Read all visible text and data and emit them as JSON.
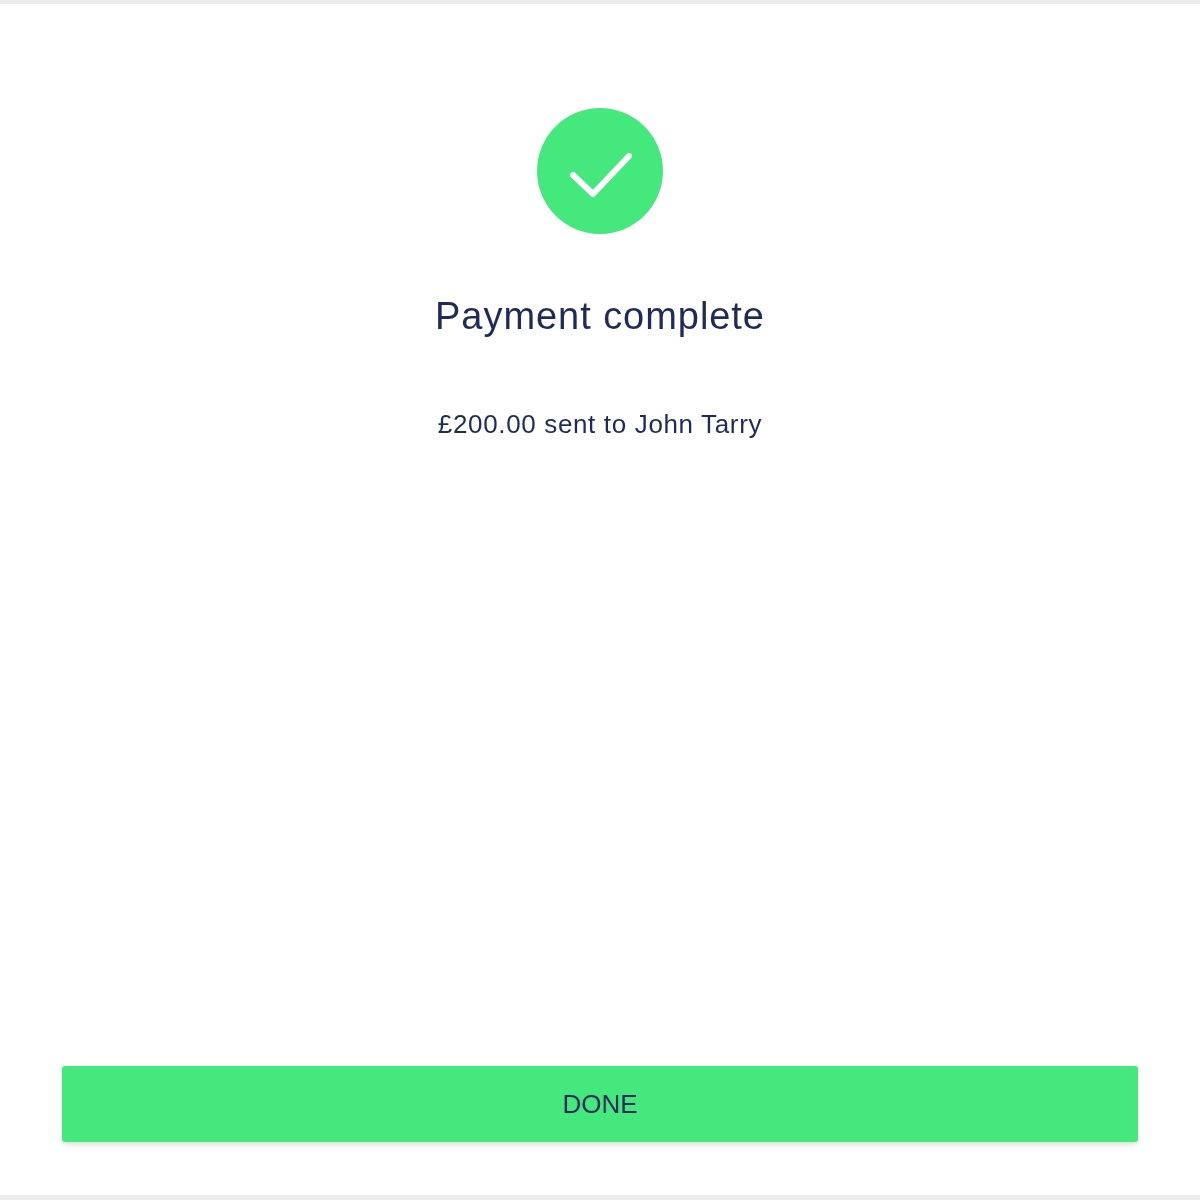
{
  "title": "Payment complete",
  "message": "£200.00 sent to John Tarry",
  "button": {
    "label": "DONE"
  }
}
